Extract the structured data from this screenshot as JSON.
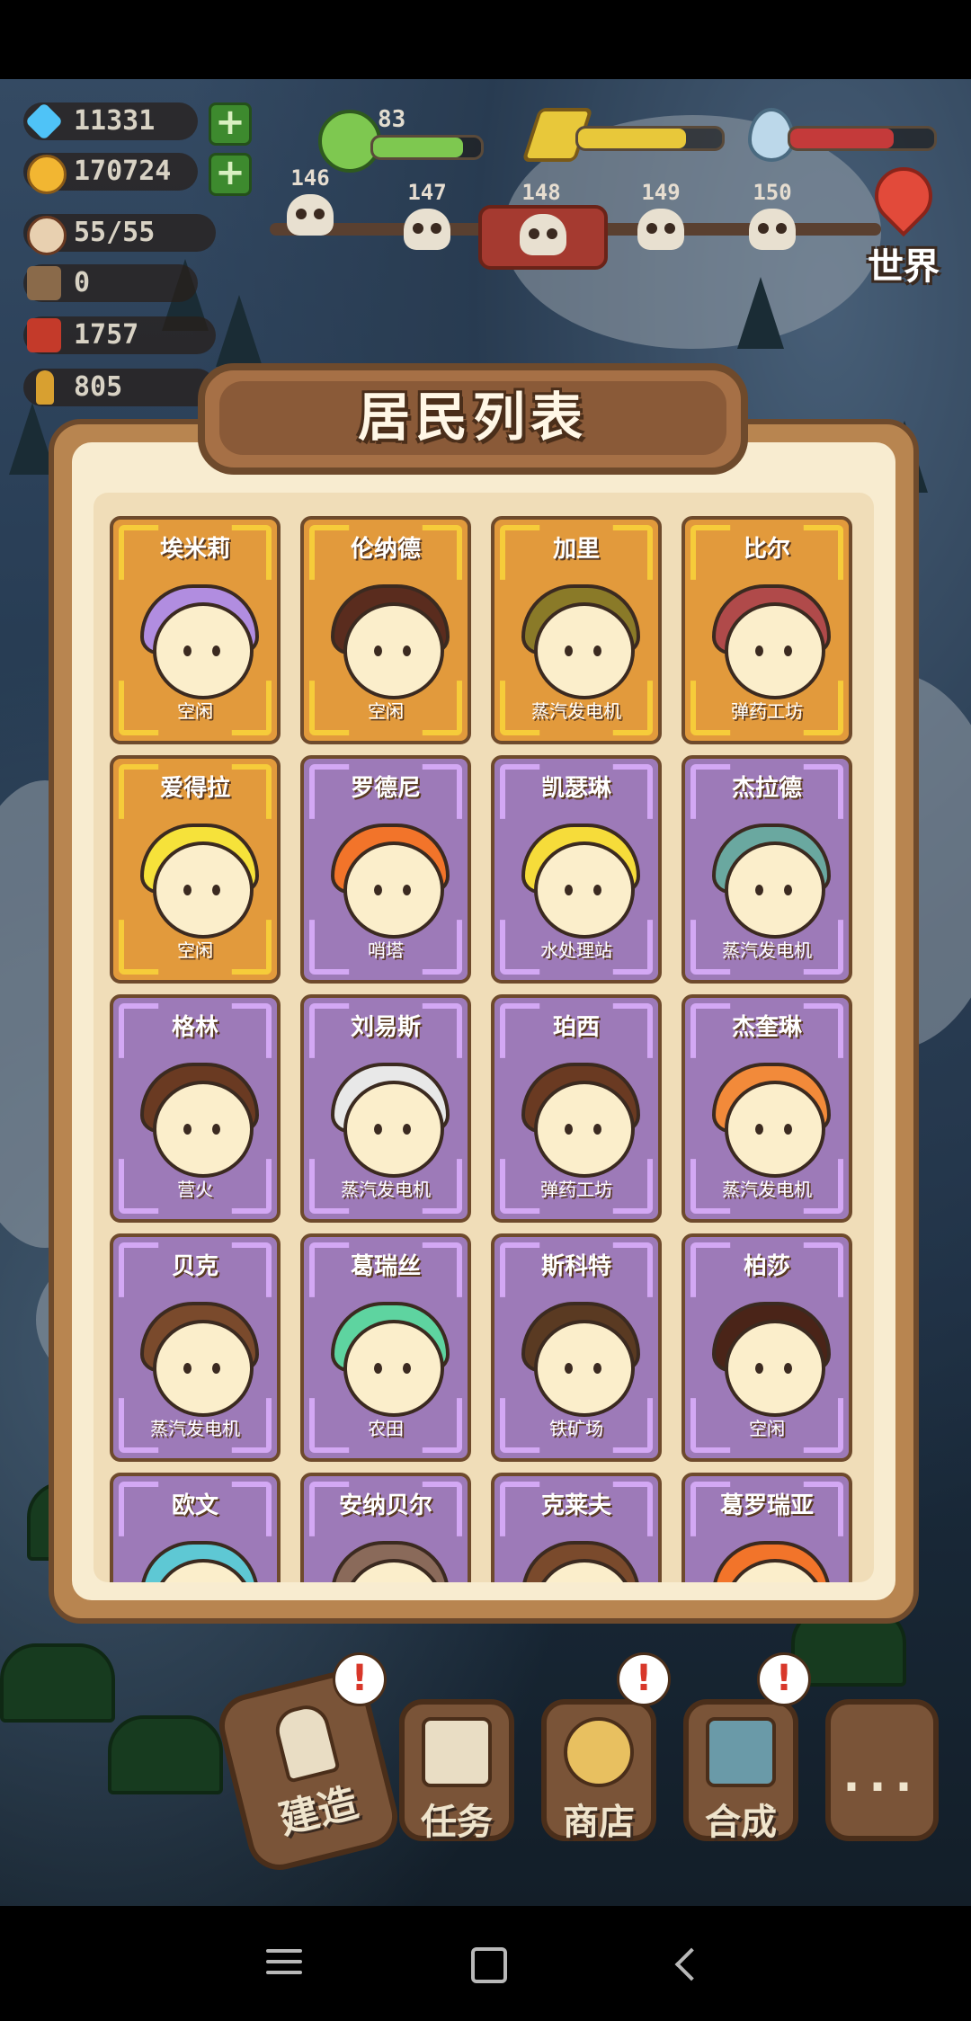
{
  "hud": {
    "diamonds": "11331",
    "coins": "170724",
    "population": "55/55",
    "wood": "0",
    "steel": "1757",
    "ammo": "805",
    "happiness": "83",
    "happiness_level": 0.83,
    "energy_level": 0.75,
    "water_level": 0.72
  },
  "days": [
    {
      "label": "146"
    },
    {
      "label": "147"
    },
    {
      "label": "148",
      "current": true
    },
    {
      "label": "149"
    },
    {
      "label": "150"
    }
  ],
  "world_button": "世界",
  "modal": {
    "title": "居民列表",
    "residents": [
      {
        "name": "埃米莉",
        "job": "空闲",
        "tier": "gold",
        "hair": "#b18de0"
      },
      {
        "name": "伦纳德",
        "job": "空闲",
        "tier": "gold",
        "hair": "#5a2c1e"
      },
      {
        "name": "加里",
        "job": "蒸汽发电机",
        "tier": "gold",
        "hair": "#8a7a28"
      },
      {
        "name": "比尔",
        "job": "弹药工坊",
        "tier": "gold",
        "hair": "#b04a4a"
      },
      {
        "name": "爱得拉",
        "job": "空闲",
        "tier": "gold",
        "hair": "#f6e23a"
      },
      {
        "name": "罗德尼",
        "job": "哨塔",
        "tier": "purple",
        "hair": "#f2742a"
      },
      {
        "name": "凯瑟琳",
        "job": "水处理站",
        "tier": "purple",
        "hair": "#f6dc3a"
      },
      {
        "name": "杰拉德",
        "job": "蒸汽发电机",
        "tier": "purple",
        "hair": "#6aa8a0"
      },
      {
        "name": "格林",
        "job": "营火",
        "tier": "purple",
        "hair": "#6a3a22"
      },
      {
        "name": "刘易斯",
        "job": "蒸汽发电机",
        "tier": "purple",
        "hair": "#e8e8e8"
      },
      {
        "name": "珀西",
        "job": "弹药工坊",
        "tier": "purple",
        "hair": "#6a3a22"
      },
      {
        "name": "杰奎琳",
        "job": "蒸汽发电机",
        "tier": "purple",
        "hair": "#f28a3a"
      },
      {
        "name": "贝克",
        "job": "蒸汽发电机",
        "tier": "purple",
        "hair": "#7a4a2c"
      },
      {
        "name": "葛瑞丝",
        "job": "农田",
        "tier": "purple",
        "hair": "#5ed4a0"
      },
      {
        "name": "斯科特",
        "job": "铁矿场",
        "tier": "purple",
        "hair": "#5a3a22"
      },
      {
        "name": "柏莎",
        "job": "空闲",
        "tier": "purple",
        "hair": "#4a2418"
      },
      {
        "name": "欧文",
        "job": "",
        "tier": "purple",
        "hair": "#5ec8d4"
      },
      {
        "name": "安纳贝尔",
        "job": "",
        "tier": "purple",
        "hair": "#8a6a5a"
      },
      {
        "name": "克莱夫",
        "job": "",
        "tier": "purple",
        "hair": "#7a4a2c"
      },
      {
        "name": "葛罗瑞亚",
        "job": "",
        "tier": "purple",
        "hair": "#f2742a"
      }
    ]
  },
  "bottom_bar": {
    "build": "建造",
    "tasks": "任务",
    "shop": "商店",
    "craft": "合成",
    "more": "..."
  },
  "colors": {
    "diamond": "#4fc3f7",
    "coin": "#f2b632",
    "happiness": "#7ec850",
    "energy": "#e8c83a",
    "water": "#c43a3a",
    "plus": "#3d8a2e"
  }
}
